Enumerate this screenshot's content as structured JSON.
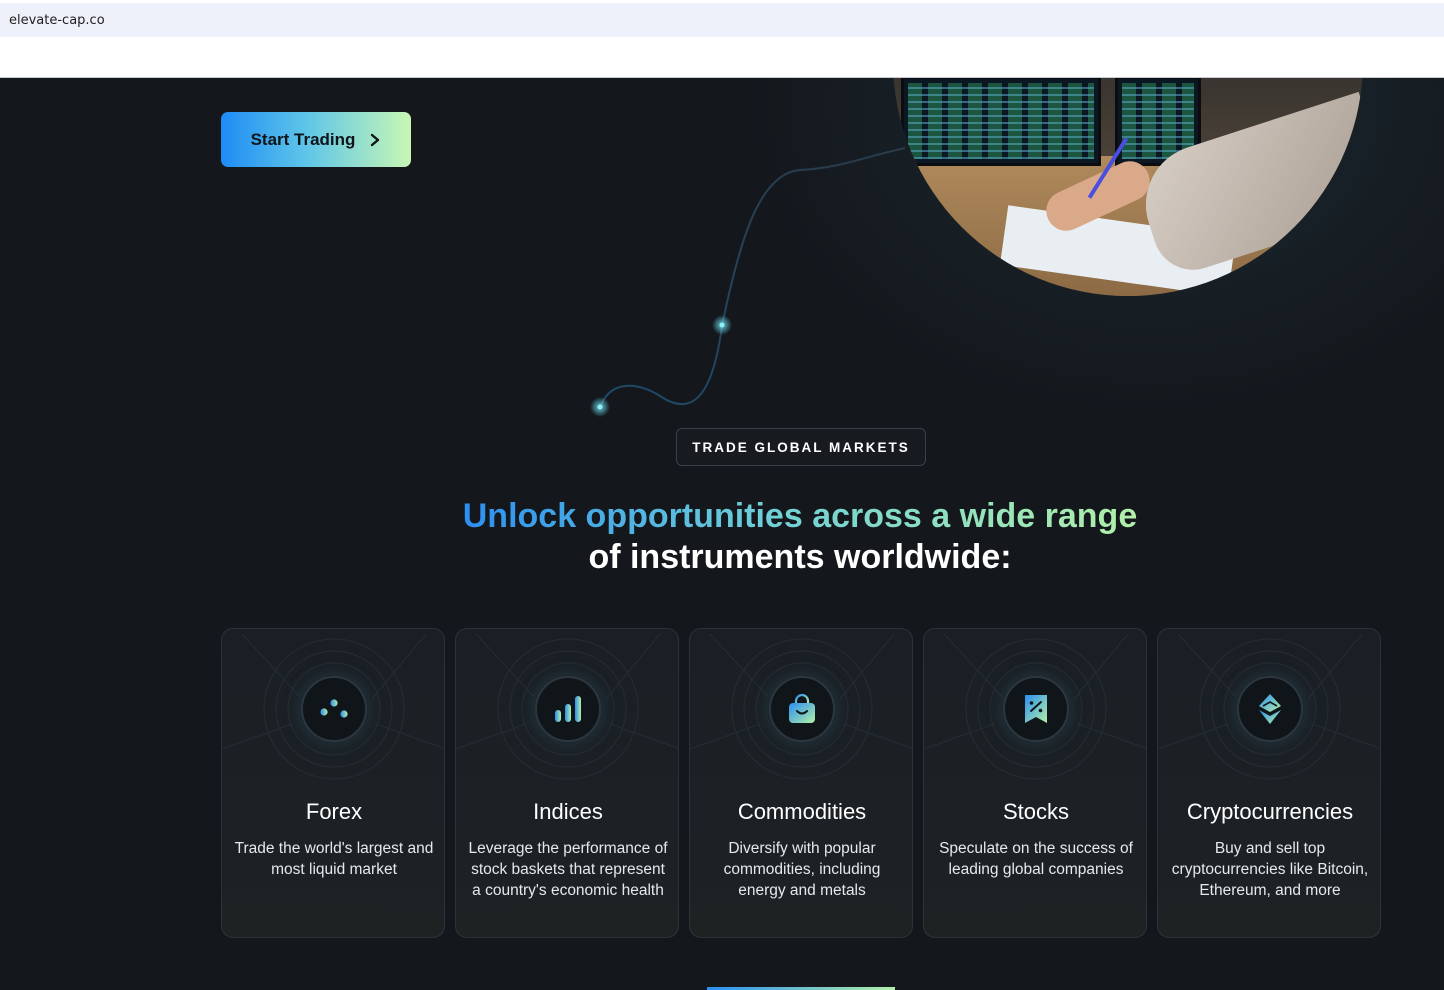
{
  "browser": {
    "url": "elevate-cap.co"
  },
  "hero": {
    "start_button_label": "Start Trading"
  },
  "markets": {
    "tag": "TRADE GLOBAL MARKETS",
    "headline_line1": "Unlock opportunities across a wide range",
    "headline_line2": "of instruments worldwide:",
    "cards": [
      {
        "title": "Forex",
        "description": "Trade the world's largest and most liquid market",
        "icon": "sliders-icon"
      },
      {
        "title": "Indices",
        "description": "Leverage the performance of stock baskets that represent a country's economic health",
        "icon": "bar-chart-icon"
      },
      {
        "title": "Commodities",
        "description": "Diversify with popular commodities, including energy and metals",
        "icon": "shopping-bag-icon"
      },
      {
        "title": "Stocks",
        "description": "Speculate on the success of leading global companies",
        "icon": "percent-tag-icon"
      },
      {
        "title": "Cryptocurrencies",
        "description": "Buy and sell top cryptocurrencies like Bitcoin, Ethereum, and more",
        "icon": "ethereum-icon"
      }
    ]
  },
  "colors": {
    "page_background": "#14181d",
    "gradient_start": "#2c8ff0",
    "gradient_end": "#b2f0a8",
    "card_border": "#2c3239"
  }
}
